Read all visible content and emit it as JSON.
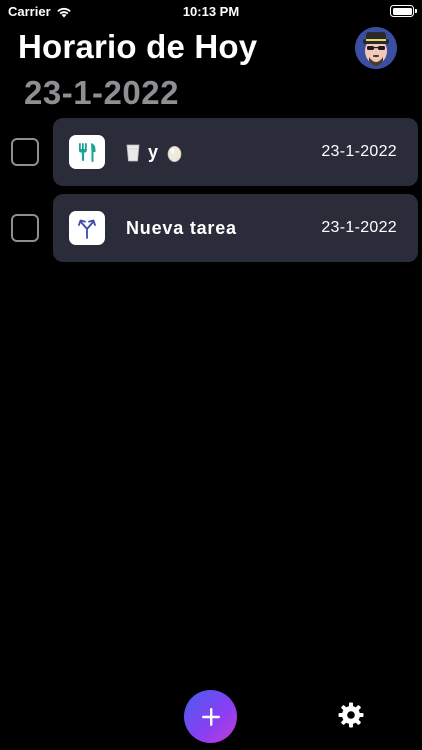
{
  "status_bar": {
    "carrier": "Carrier",
    "time": "10:13 PM"
  },
  "header": {
    "title": "Horario de Hoy",
    "date": "23-1-2022"
  },
  "tasks": [
    {
      "title_parts": [
        "y"
      ],
      "date": "23-1-2022",
      "icon": "utensils-icon",
      "icon_color": "#1aa39a",
      "checked": false
    },
    {
      "title": "Nueva tarea",
      "date": "23-1-2022",
      "icon": "merge-arrows-icon",
      "icon_color": "#3e4aa8",
      "checked": false
    }
  ],
  "colors": {
    "background": "#000000",
    "card": "#2a2c3a",
    "muted_text": "#8e8e93",
    "add_gradient": [
      "#4a5cf0",
      "#c73bd8"
    ]
  },
  "bottom_bar": {
    "add_icon": "plus-icon",
    "settings_icon": "gear-icon"
  }
}
